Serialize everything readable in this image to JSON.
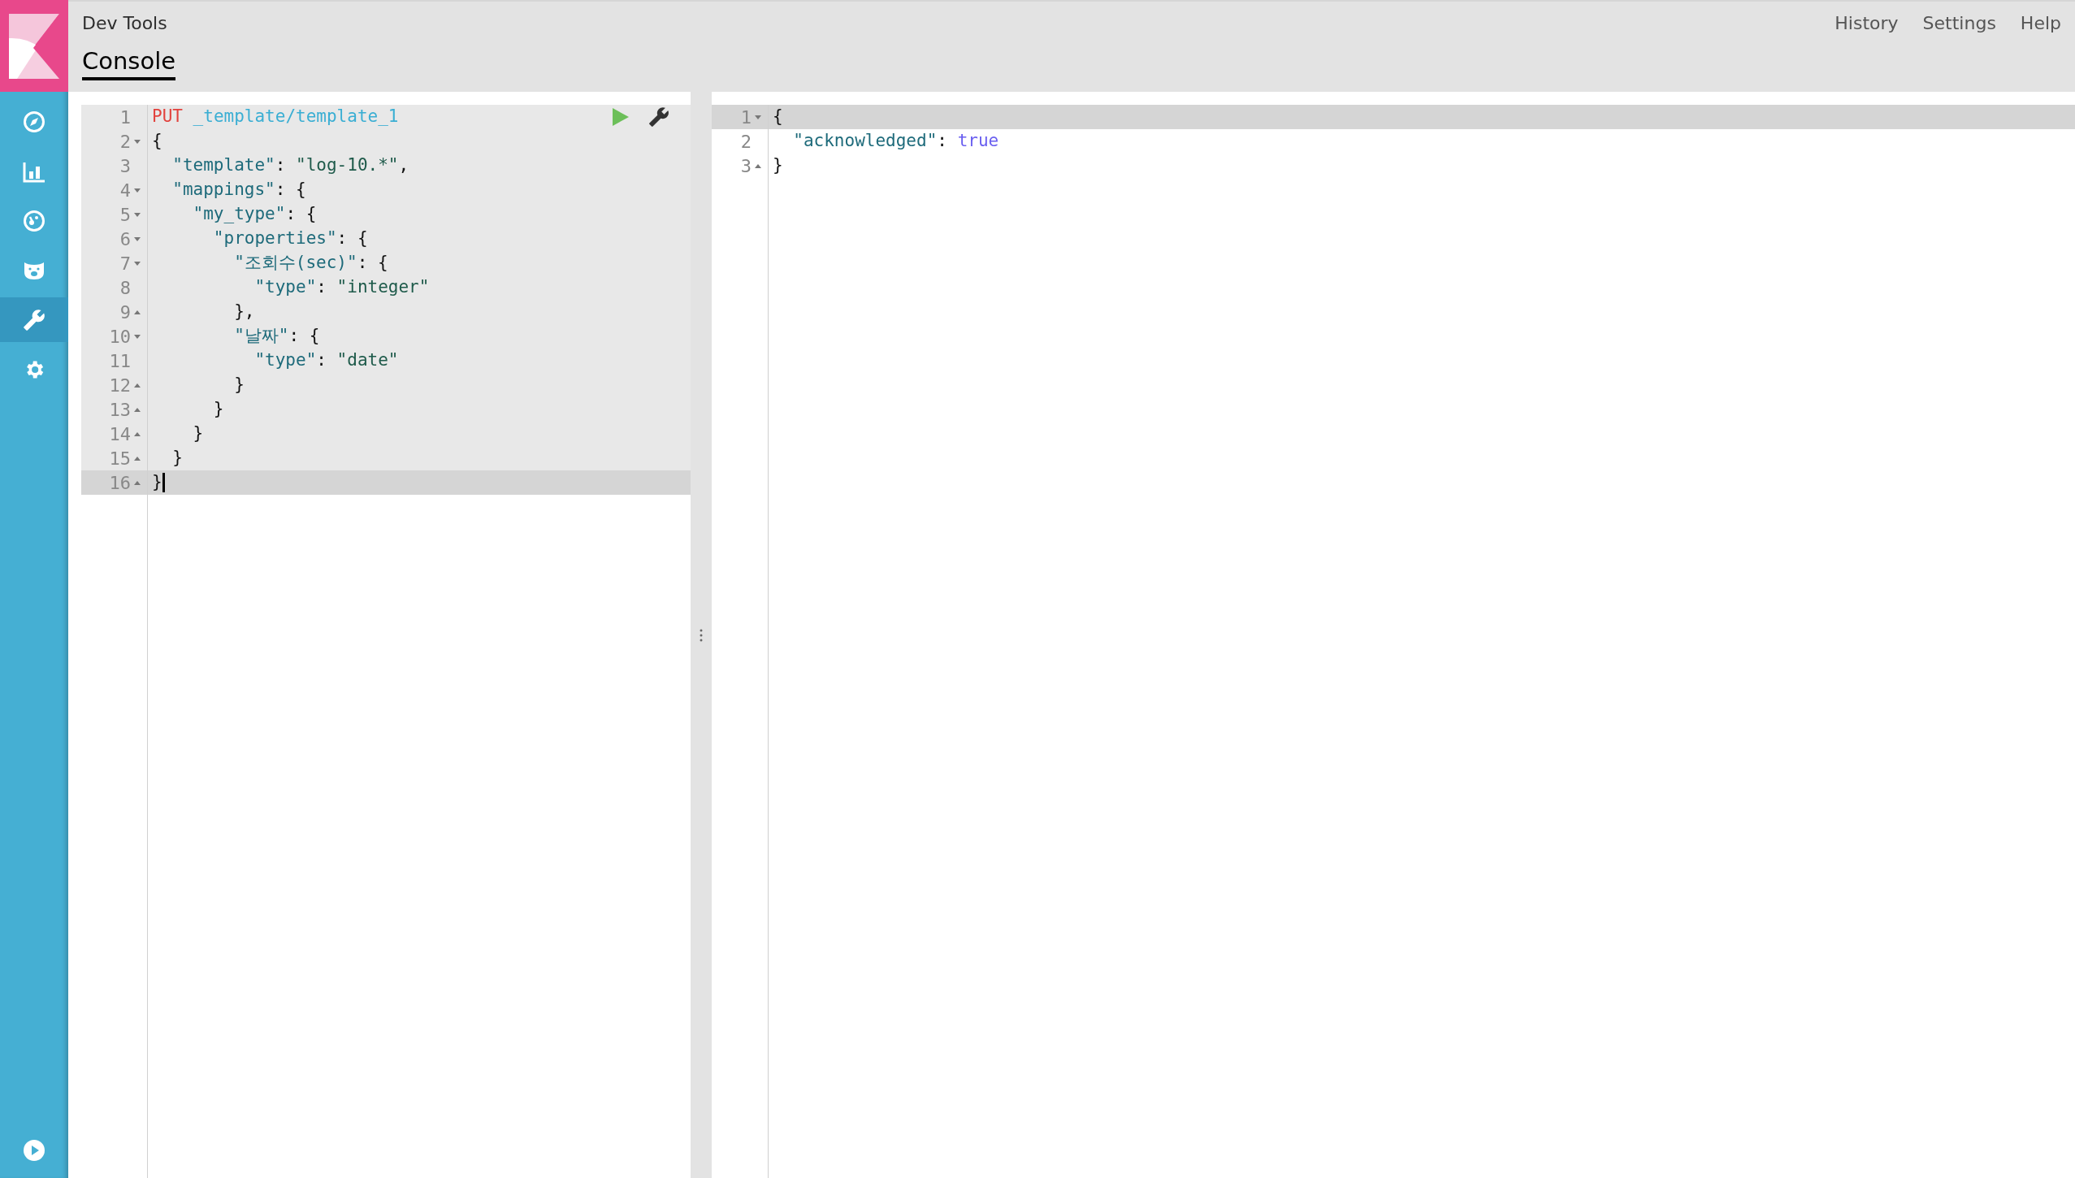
{
  "sidebar": {
    "items": [
      {
        "kind": "compass",
        "selected": false
      },
      {
        "kind": "chart",
        "selected": false
      },
      {
        "kind": "gauge",
        "selected": false
      },
      {
        "kind": "bear",
        "selected": false
      },
      {
        "kind": "wrench",
        "selected": true
      },
      {
        "kind": "gear",
        "selected": false
      }
    ],
    "bottom": {
      "kind": "play"
    }
  },
  "header": {
    "title": "Dev Tools",
    "links": [
      "History",
      "Settings",
      "Help"
    ],
    "tabs": [
      {
        "label": "Console",
        "selected": true
      }
    ]
  },
  "editor": {
    "lines": [
      {
        "number": "1",
        "fold_start": false,
        "fold_end": false,
        "active": false,
        "cursor": false,
        "tokens": [
          {
            "kind": "method",
            "text": "PUT"
          },
          {
            "kind": "url",
            "text": "_template/template_1"
          }
        ]
      },
      {
        "number": "2",
        "fold_start": true,
        "fold_end": false,
        "active": false,
        "cursor": false,
        "tokens": [
          {
            "kind": "punct",
            "text": "{"
          }
        ]
      },
      {
        "number": "3",
        "fold_start": false,
        "fold_end": false,
        "active": false,
        "cursor": false,
        "tokens": [
          {
            "kind": "key",
            "text": "\"template\""
          },
          {
            "kind": "punct",
            "text": ":"
          },
          {
            "kind": "string",
            "text": "\"log-10.*\""
          },
          {
            "kind": "punct",
            "text": ","
          }
        ]
      },
      {
        "number": "4",
        "fold_start": true,
        "fold_end": false,
        "active": false,
        "cursor": false,
        "tokens": [
          {
            "kind": "key",
            "text": "\"mappings\""
          },
          {
            "kind": "punct",
            "text": ":"
          },
          {
            "kind": "punct",
            "text": "{"
          }
        ]
      },
      {
        "number": "5",
        "fold_start": true,
        "fold_end": false,
        "active": false,
        "cursor": false,
        "tokens": [
          {
            "kind": "key",
            "text": "\"my_type\""
          },
          {
            "kind": "punct",
            "text": ":"
          },
          {
            "kind": "punct",
            "text": "{"
          }
        ]
      },
      {
        "number": "6",
        "fold_start": true,
        "fold_end": false,
        "active": false,
        "cursor": false,
        "tokens": [
          {
            "kind": "key",
            "text": "\"properties\""
          },
          {
            "kind": "punct",
            "text": ":"
          },
          {
            "kind": "punct",
            "text": "{"
          }
        ]
      },
      {
        "number": "7",
        "fold_start": true,
        "fold_end": false,
        "active": false,
        "cursor": false,
        "tokens": [
          {
            "kind": "key",
            "text": "\"조회수(sec)\""
          },
          {
            "kind": "punct",
            "text": ":"
          },
          {
            "kind": "punct",
            "text": "{"
          }
        ]
      },
      {
        "number": "8",
        "fold_start": false,
        "fold_end": false,
        "active": false,
        "cursor": false,
        "tokens": [
          {
            "kind": "key",
            "text": "\"type\""
          },
          {
            "kind": "punct",
            "text": ":"
          },
          {
            "kind": "string",
            "text": "\"integer\""
          }
        ]
      },
      {
        "number": "9",
        "fold_start": false,
        "fold_end": true,
        "active": false,
        "cursor": false,
        "tokens": [
          {
            "kind": "punct",
            "text": "},"
          }
        ]
      },
      {
        "number": "10",
        "fold_start": true,
        "fold_end": false,
        "active": false,
        "cursor": false,
        "tokens": [
          {
            "kind": "key",
            "text": "\"날짜\""
          },
          {
            "kind": "punct",
            "text": ":"
          },
          {
            "kind": "punct",
            "text": "{"
          }
        ]
      },
      {
        "number": "11",
        "fold_start": false,
        "fold_end": false,
        "active": false,
        "cursor": false,
        "tokens": [
          {
            "kind": "key",
            "text": "\"type\""
          },
          {
            "kind": "punct",
            "text": ":"
          },
          {
            "kind": "string",
            "text": "\"date\""
          }
        ]
      },
      {
        "number": "12",
        "fold_start": false,
        "fold_end": true,
        "active": false,
        "cursor": false,
        "tokens": [
          {
            "kind": "punct",
            "text": "}"
          }
        ]
      },
      {
        "number": "13",
        "fold_start": false,
        "fold_end": true,
        "active": false,
        "cursor": false,
        "tokens": [
          {
            "kind": "punct",
            "text": "}"
          }
        ]
      },
      {
        "number": "14",
        "fold_start": false,
        "fold_end": true,
        "active": false,
        "cursor": false,
        "tokens": [
          {
            "kind": "punct",
            "text": "}"
          }
        ]
      },
      {
        "number": "15",
        "fold_start": false,
        "fold_end": true,
        "active": false,
        "cursor": false,
        "tokens": [
          {
            "kind": "punct",
            "text": "}"
          }
        ]
      },
      {
        "number": "16",
        "fold_start": false,
        "fold_end": true,
        "active": true,
        "cursor": true,
        "tokens": [
          {
            "kind": "punct",
            "text": "}"
          }
        ]
      }
    ]
  },
  "output": {
    "lines": [
      {
        "number": "1",
        "fold_start": true,
        "fold_end": false,
        "active": true,
        "cursor": false,
        "tokens": [
          {
            "kind": "punct",
            "text": "{"
          }
        ]
      },
      {
        "number": "2",
        "fold_start": false,
        "fold_end": false,
        "active": false,
        "cursor": false,
        "tokens": [
          {
            "kind": "key",
            "text": "\"acknowledged\""
          },
          {
            "kind": "punct",
            "text": ":"
          },
          {
            "kind": "boolean",
            "text": "true"
          }
        ]
      },
      {
        "number": "3",
        "fold_start": false,
        "fold_end": true,
        "active": false,
        "cursor": false,
        "tokens": [
          {
            "kind": "punct",
            "text": "}"
          }
        ]
      }
    ]
  }
}
